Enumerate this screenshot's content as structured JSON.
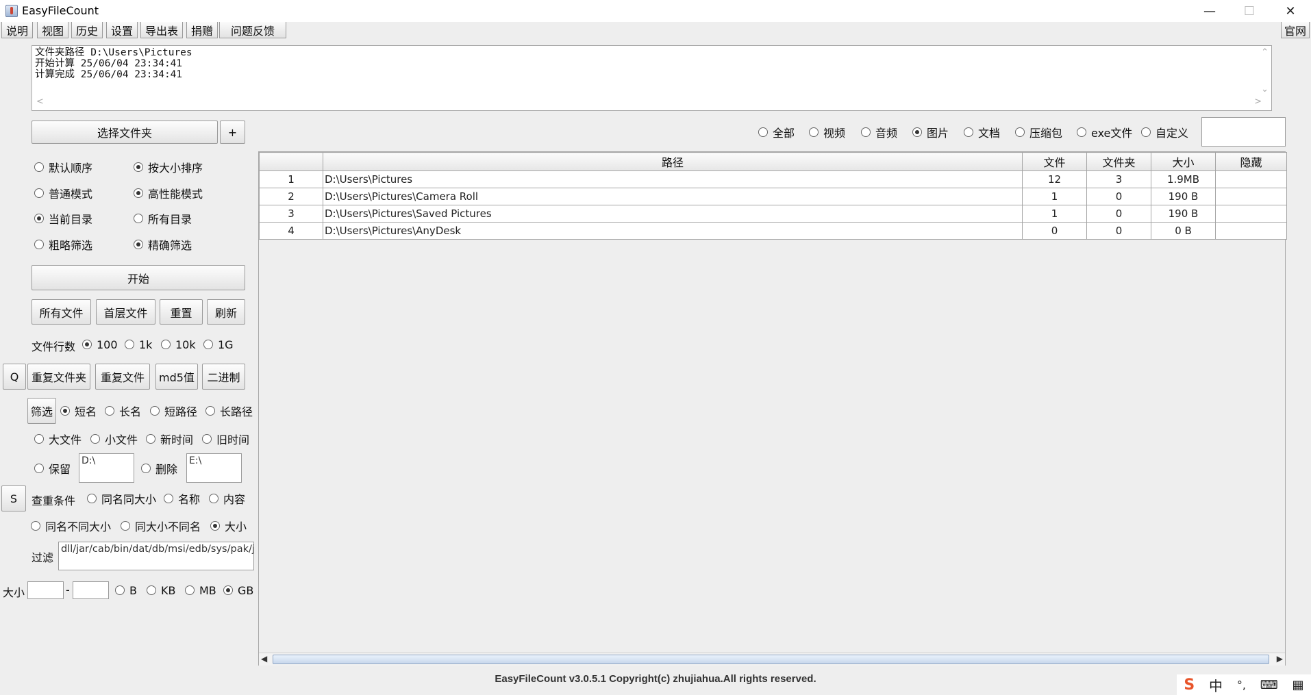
{
  "window": {
    "title": "EasyFileCount"
  },
  "menu": {
    "items": [
      "说明",
      "视图",
      "历史",
      "设置",
      "导出表",
      "捐赠",
      "问题反馈"
    ],
    "right": "官网"
  },
  "log": {
    "lines": [
      "文件夹路径 D:\\Users\\Pictures",
      "开始计算 25/06/04 23:34:41",
      "计算完成 25/06/04 23:34:41"
    ]
  },
  "left": {
    "select_folder": "选择文件夹",
    "plus": "+",
    "sort_default": "默认顺序",
    "sort_size": "按大小排序",
    "mode_normal": "普通模式",
    "mode_perf": "高性能模式",
    "dir_current": "当前目录",
    "dir_all": "所有目录",
    "filter_rough": "粗略筛选",
    "filter_exact": "精确筛选",
    "start": "开始",
    "btn_all_files": "所有文件",
    "btn_top_files": "首层文件",
    "btn_reset": "重置",
    "btn_refresh": "刷新",
    "rows_label": "文件行数",
    "rows_100": "100",
    "rows_1k": "1k",
    "rows_10k": "10k",
    "rows_1g": "1G",
    "btn_q": "Q",
    "btn_dup_folder": "重复文件夹",
    "btn_dup_file": "重复文件",
    "btn_md5": "md5值",
    "btn_binary": "二进制",
    "btn_filter": "筛选",
    "f_short_name": "短名",
    "f_long_name": "长名",
    "f_short_path": "短路径",
    "f_long_path": "长路径",
    "f_big": "大文件",
    "f_small": "小文件",
    "f_new": "新时间",
    "f_old": "旧时间",
    "keep": "保留",
    "keep_value": "D:\\",
    "delete": "删除",
    "delete_value": "E:\\",
    "btn_s": "S",
    "dup_cond": "查重条件",
    "d_same_name_size": "同名同大小",
    "d_name": "名称",
    "d_content": "内容",
    "d_same_name_diff_size": "同名不同大小",
    "d_same_size_diff_name": "同大小不同名",
    "d_size": "大小",
    "filter_label": "过滤",
    "filter_value": "dll/jar/cab/bin/dat/db/msi/edb/sys/pak/jsa",
    "size_label": "大小",
    "size_dash": "-",
    "u_b": "B",
    "u_kb": "KB",
    "u_mb": "MB",
    "u_gb": "GB"
  },
  "types": {
    "all": "全部",
    "video": "视频",
    "audio": "音频",
    "image": "图片",
    "doc": "文档",
    "zip": "压缩包",
    "exe": "exe文件",
    "custom": "自定义"
  },
  "table": {
    "headers": [
      "",
      "路径",
      "文件",
      "文件夹",
      "大小",
      "隐藏"
    ],
    "rows": [
      [
        "1",
        "D:\\Users\\Pictures",
        "12",
        "3",
        "1.9MB",
        ""
      ],
      [
        "2",
        "D:\\Users\\Pictures\\Camera Roll",
        "1",
        "0",
        "190 B",
        ""
      ],
      [
        "3",
        "D:\\Users\\Pictures\\Saved Pictures",
        "1",
        "0",
        "190 B",
        ""
      ],
      [
        "4",
        "D:\\Users\\Pictures\\AnyDesk",
        "0",
        "0",
        "0 B",
        ""
      ]
    ]
  },
  "footer": "EasyFileCount v3.0.5.1 Copyright(c) zhujiahua.All rights reserved.",
  "ime": {
    "zh": "中",
    "punct": "°,"
  }
}
